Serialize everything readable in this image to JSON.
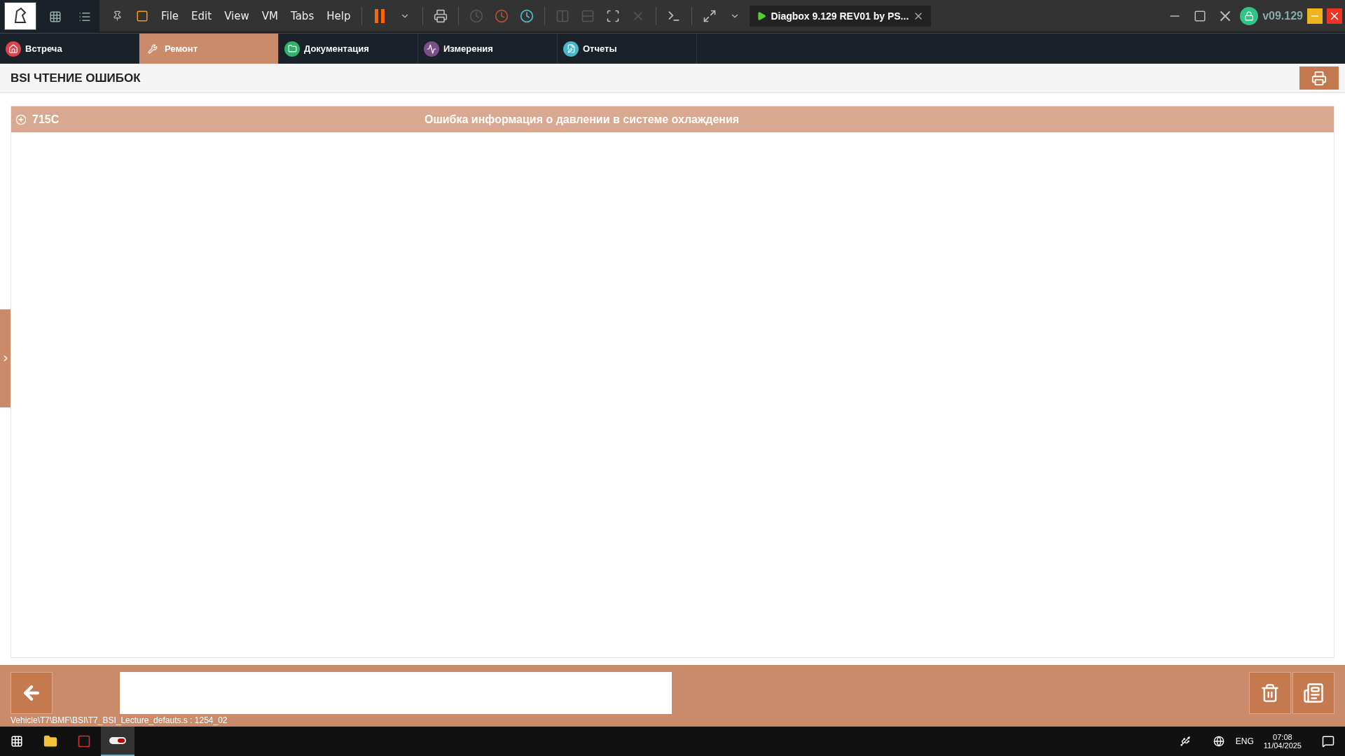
{
  "vm_toolbar": {
    "menu": [
      {
        "label": "File"
      },
      {
        "label": "Edit"
      },
      {
        "label": "View"
      },
      {
        "label": "VM"
      },
      {
        "label": "Tabs"
      },
      {
        "label": "Help"
      }
    ],
    "vm_tab": {
      "title": "Diagbox 9.129 REV01 by PS..."
    },
    "version": "v09.129"
  },
  "app_tabs": [
    {
      "label": "Встреча",
      "selected": false,
      "kind": "home",
      "color": "#d9434f"
    },
    {
      "label": "Ремонт",
      "selected": true,
      "kind": "repair",
      "color": "#c98b6a"
    },
    {
      "label": "Документация",
      "selected": false,
      "kind": "folder",
      "color": "#2fb36b"
    },
    {
      "label": "Измерения",
      "selected": false,
      "kind": "wave",
      "color": "#7a4f8a"
    },
    {
      "label": "Отчеты",
      "selected": false,
      "kind": "report",
      "color": "#4ab6c6"
    }
  ],
  "page": {
    "title": "BSI ЧТЕНИЕ ОШИБОК"
  },
  "faults": [
    {
      "code": "715C",
      "description": "Ошибка информация о давлении в системе охлаждения",
      "expanded": false
    }
  ],
  "status": {
    "path": "Vehicle\\T7\\BMF\\BSI\\T7_BSI_Lecture_defauts.s : 1254_02"
  },
  "taskbar": {
    "language": "ENG",
    "time": "07:08",
    "date": "11/04/2025"
  }
}
